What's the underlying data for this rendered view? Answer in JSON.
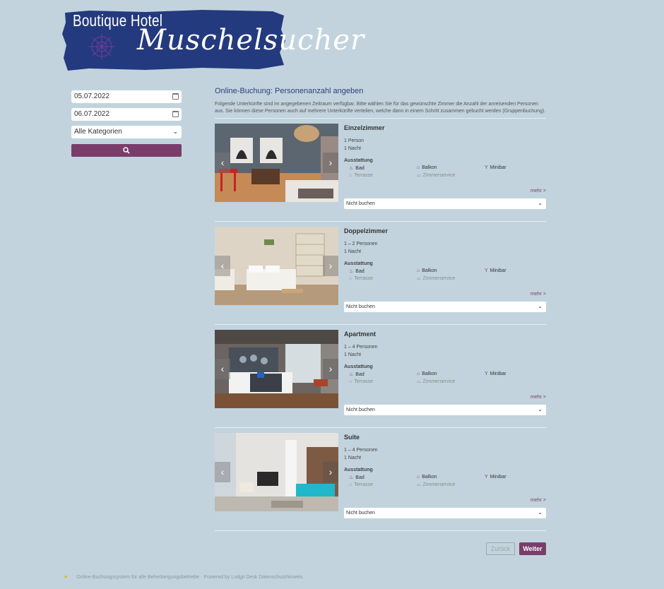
{
  "logo": {
    "line1": "Boutique Hotel",
    "line2": "Muschelsucher"
  },
  "sidebar": {
    "date_from": "05.07.2022",
    "date_to": "06.07.2022",
    "category": "Alle Kategorien"
  },
  "main": {
    "title": "Online-Buchung: Personenanzahl angeben",
    "intro": "Folgende Unterkünfte sind im angegebenen Zeitraum verfügbar. Bitte wählen Sie für das gewünschte Zimmer die Anzahl der anreisenden Personen aus. Sie können diese Personen auch auf mehrere Unterkünfte verteilen, welche dann in einem Schritt zusammen gebucht werden (Gruppenbuchung).",
    "rooms": [
      {
        "name": "Einzelzimmer",
        "persons": "1 Person",
        "nights": "1 Nacht",
        "amenities_label": "Ausstattung",
        "bad": "Bad",
        "balkon": "Balkon",
        "minibar": "Minibar",
        "terrasse": "Terrasse",
        "zimmerservice": "Zimmerservice",
        "more": "mehr >",
        "select": "Nicht buchen"
      },
      {
        "name": "Doppelzimmer",
        "persons": "1 – 2 Personen",
        "nights": "1 Nacht",
        "amenities_label": "Ausstattung",
        "bad": "Bad",
        "balkon": "Balkon",
        "minibar": "Minibar",
        "terrasse": "Terrasse",
        "zimmerservice": "Zimmerservice",
        "more": "mehr >",
        "select": "Nicht buchen"
      },
      {
        "name": "Apartment",
        "persons": "1 – 4 Personen",
        "nights": "1 Nacht",
        "amenities_label": "Ausstattung",
        "bad": "Bad",
        "balkon": "Balkon",
        "minibar": "Minibar",
        "terrasse": "Terrasse",
        "zimmerservice": "Zimmerservice",
        "more": "mehr >",
        "select": "Nicht buchen"
      },
      {
        "name": "Suite",
        "persons": "1 – 4 Personen",
        "nights": "1 Nacht",
        "amenities_label": "Ausstattung",
        "bad": "Bad",
        "balkon": "Balkon",
        "minibar": "Minibar",
        "terrasse": "Terrasse",
        "zimmerservice": "Zimmerservice",
        "more": "mehr >",
        "select": "Nicht buchen"
      }
    ],
    "back": "Zurück",
    "next": "Weiter"
  },
  "footer": {
    "text": "Online-Buchungssystem für alle Beherbergungsbetriebe  ·  Powered by Lodgit Desk  Datenschutzhinweis"
  },
  "colors": {
    "accent": "#7a3d6b",
    "background": "#c2d3dd",
    "logo_bg": "#243a7e",
    "title": "#2c3f7a"
  },
  "icons": {
    "search": "search-icon",
    "calendar": "calendar-icon",
    "bath": "bathtub-icon",
    "balcony": "balcony-icon",
    "minibar": "cocktail-icon",
    "terrace": "terrace-icon",
    "room_service": "room-service-icon"
  }
}
